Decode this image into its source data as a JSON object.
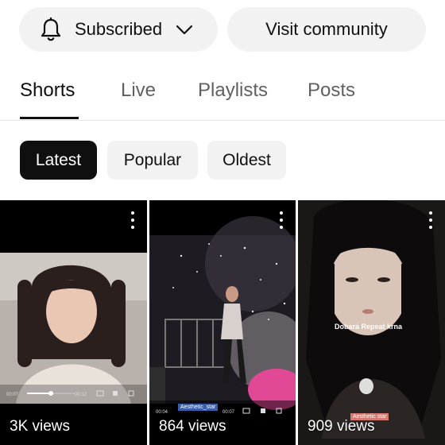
{
  "actions": {
    "subscribed_label": "Subscribed",
    "visit_label": "Visit community"
  },
  "tabs": [
    {
      "label": "Shorts",
      "active": true
    },
    {
      "label": "Live",
      "active": false
    },
    {
      "label": "Playlists",
      "active": false
    },
    {
      "label": "Posts",
      "active": false
    }
  ],
  "filters": [
    {
      "label": "Latest",
      "active": true
    },
    {
      "label": "Popular",
      "active": false
    },
    {
      "label": "Oldest",
      "active": false
    }
  ],
  "shorts": [
    {
      "views": "3K views",
      "player_time_start": "00:07",
      "player_time_end": "00:12"
    },
    {
      "views": "864 views",
      "tag": "Aesthetic_star",
      "player_time_start": "00:04",
      "player_time_end": "00:07"
    },
    {
      "views": "909 views",
      "caption": "Dobara Repeat krna",
      "tag": "Aesthetic star"
    }
  ],
  "colors": {
    "pill_bg": "#f2f2f2",
    "text_primary": "#0f0f0f",
    "text_secondary": "#606060",
    "chip_active_bg": "#0f0f0f"
  },
  "icons": {
    "bell": "bell-icon",
    "chevron": "chevron-down-icon",
    "more": "more-vert-icon"
  }
}
